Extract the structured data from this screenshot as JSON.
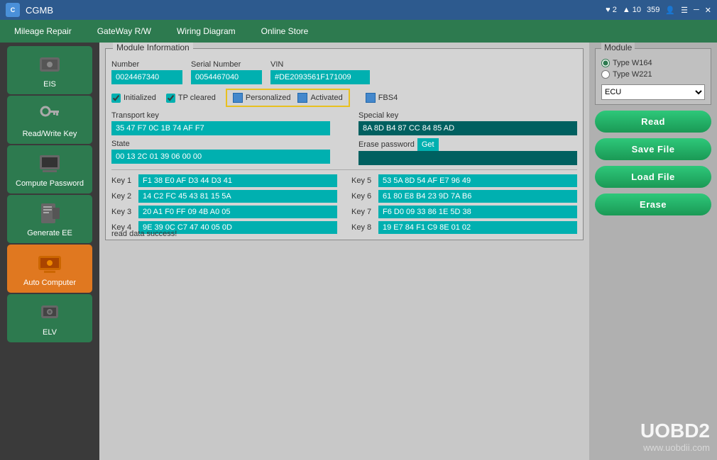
{
  "titlebar": {
    "logo": "C",
    "title": "CGMB",
    "battery": "2",
    "wifi": "10",
    "signal": "359"
  },
  "nav": {
    "items": [
      "Mileage Repair",
      "GateWay R/W",
      "Wiring Diagram",
      "Online Store"
    ]
  },
  "sidebar": {
    "items": [
      {
        "id": "eis",
        "label": "EIS",
        "icon": "🔧"
      },
      {
        "id": "read-write-key",
        "label": "Read/Write Key",
        "icon": "🔑"
      },
      {
        "id": "compute-password",
        "label": "Compute Password",
        "icon": "💻"
      },
      {
        "id": "generate-ee",
        "label": "Generate EE",
        "icon": "🖨"
      },
      {
        "id": "auto-computer",
        "label": "Auto Computer",
        "icon": "🖥",
        "active": true
      },
      {
        "id": "elv",
        "label": "ELV",
        "icon": "📷"
      }
    ]
  },
  "module_info": {
    "title": "Module Information",
    "number_label": "Number",
    "number_value": "0024467340",
    "serial_label": "Serial Number",
    "serial_value": "0054467040",
    "vin_label": "VIN",
    "vin_value": "#DE2093561F171009",
    "initialized": true,
    "tp_cleared": true,
    "personalized": false,
    "activated": false,
    "fbs4": false,
    "transport_key_label": "Transport key",
    "transport_key_value": "35 47 F7 0C 1B 74 AF F7",
    "state_label": "State",
    "state_value": "00 13 2C 01 39 06 00 00",
    "special_key_label": "Special key",
    "special_key_value": "8A 8D B4 87 CC 84 85 AD",
    "erase_password_label": "Erase password",
    "erase_password_value": "",
    "keys": [
      {
        "label": "Key 1",
        "value": "F1 38 E0 AF D3 44 D3 41"
      },
      {
        "label": "Key 2",
        "value": "14 C2 FC 45 43 81 15 5A"
      },
      {
        "label": "Key 3",
        "value": "20 A1 F0 FF 09 4B A0 05"
      },
      {
        "label": "Key 4",
        "value": "9E 39 0C C7 47 40 05 0D"
      },
      {
        "label": "Key 5",
        "value": "53 5A 8D 54 AF E7 96 49"
      },
      {
        "label": "Key 6",
        "value": "61 80 E8 B4 23 9D 7A B6"
      },
      {
        "label": "Key 7",
        "value": "F6 D0 09 33 86 1E 5D 38"
      },
      {
        "label": "Key 8",
        "value": "19 E7 84 F1 C9 8E 01 02"
      }
    ],
    "status": "read data success!"
  },
  "module_panel": {
    "title": "Module",
    "type_w164": "Type W164",
    "type_w221": "Type W221",
    "ecu_label": "ECU",
    "ecu_options": [
      "ECU"
    ]
  },
  "buttons": {
    "read": "Read",
    "save_file": "Save File",
    "load_file": "Load File",
    "erase": "Erase"
  },
  "watermark": {
    "main": "UOBD2",
    "sub": "www.uobdii.com"
  }
}
